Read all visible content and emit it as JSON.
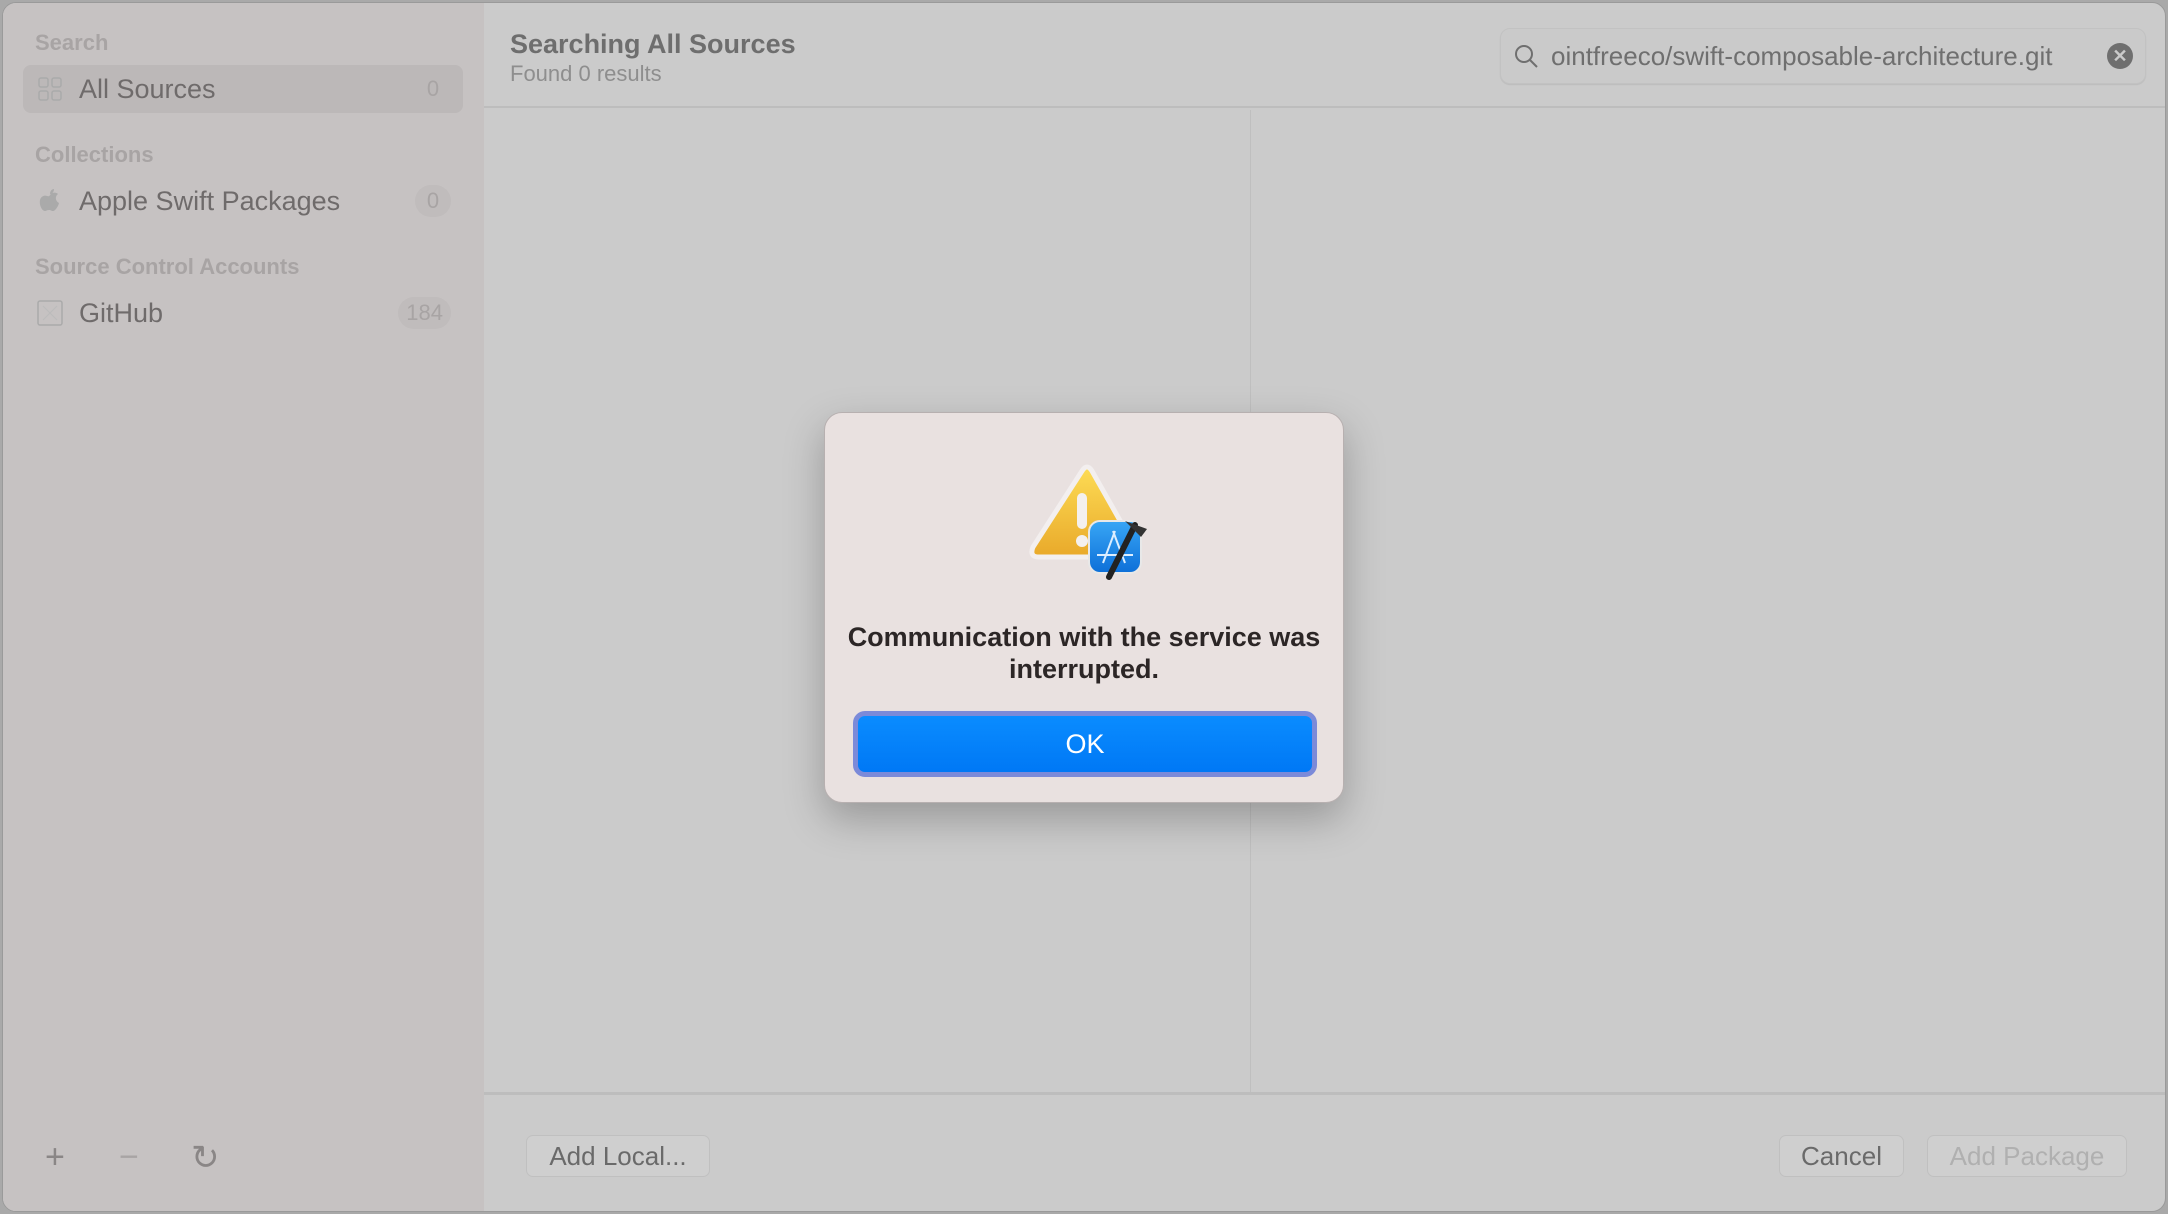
{
  "sidebar": {
    "search_header": "Search",
    "all_sources": {
      "label": "All Sources",
      "count": "0",
      "icon": "grid-icon"
    },
    "collections_header": "Collections",
    "collections": [
      {
        "label": "Apple Swift Packages",
        "count": "0",
        "icon": "apple-logo-icon"
      }
    ],
    "accounts_header": "Source Control Accounts",
    "accounts": [
      {
        "label": "GitHub",
        "count": "184",
        "icon": "github-placeholder-icon"
      }
    ],
    "footer": {
      "add": "+",
      "remove": "−",
      "refresh": "↻"
    }
  },
  "header": {
    "title": "Searching All Sources",
    "subtitle": "Found 0 results"
  },
  "search": {
    "value": "ointfreeco/swift-composable-architecture.git"
  },
  "footer": {
    "add_local": "Add Local...",
    "cancel": "Cancel",
    "add_package": "Add Package"
  },
  "alert": {
    "message": "Communication with the service was interrupted.",
    "ok": "OK",
    "icon": "warning-xcode-icon"
  },
  "colors": {
    "accent": "#0a84ff"
  }
}
